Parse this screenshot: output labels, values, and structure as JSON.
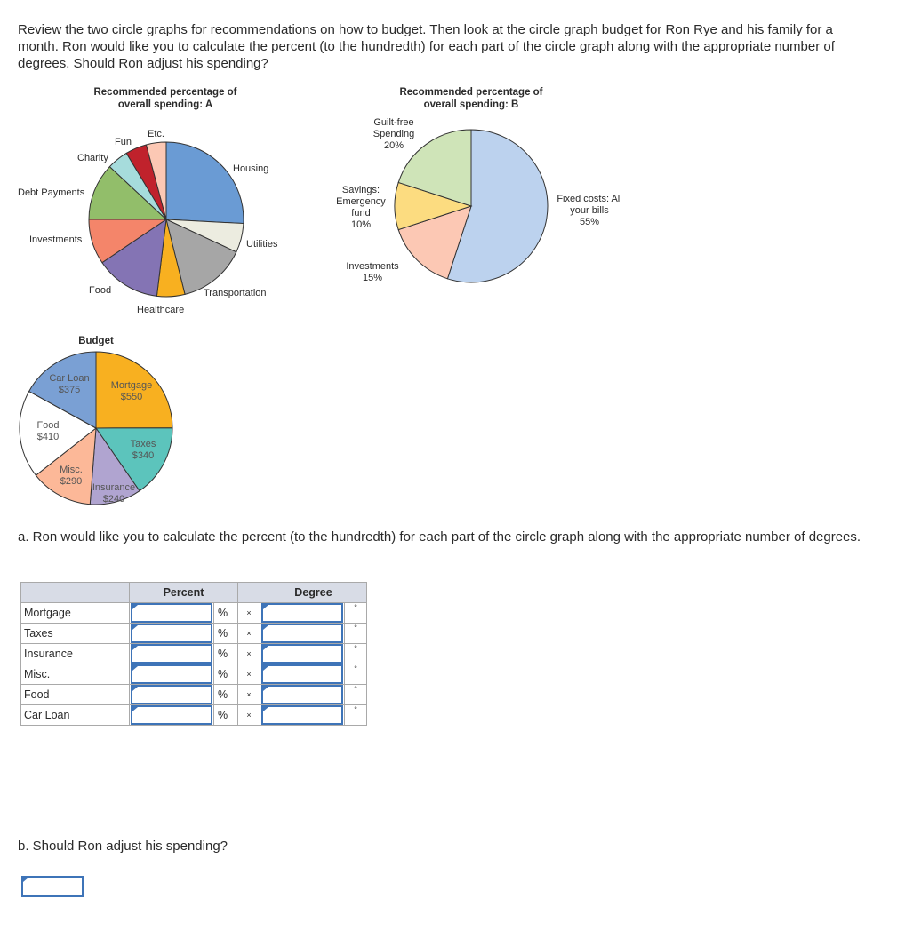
{
  "intro": "Review the two circle graphs for recommendations on how to budget. Then look at the circle graph budget for Ron Rye and his family for a month. Ron would like you to calculate the percent (to the hundredth) for each part of the circle graph along with the appropriate number of degrees. Should Ron adjust his spending?",
  "chart_data": [
    {
      "type": "pie",
      "title": "Recommended percentage of overall spending: A",
      "title_l1": "Recommended percentage of",
      "title_l2": "overall spending: A",
      "slices": [
        {
          "label": "Housing",
          "color": "#6a9bd4",
          "approx_deg": 93
        },
        {
          "label": "Utilities",
          "color": "#ecece0",
          "approx_deg": 22
        },
        {
          "label": "Transportation",
          "color": "#a6a6a6",
          "approx_deg": 51
        },
        {
          "label": "Healthcare",
          "color": "#f8b020",
          "approx_deg": 21
        },
        {
          "label": "Food",
          "color": "#8474b4",
          "approx_deg": 49
        },
        {
          "label": "Investments",
          "color": "#f4856a",
          "approx_deg": 34
        },
        {
          "label": "Debt Payments",
          "color": "#92be6a",
          "approx_deg": 43
        },
        {
          "label": "Charity",
          "color": "#a6dcdc",
          "approx_deg": 16
        },
        {
          "label": "Fun",
          "color": "#c0222c",
          "approx_deg": 16
        },
        {
          "label": "Etc.",
          "color": "#fcc8b4",
          "approx_deg": 15
        }
      ]
    },
    {
      "type": "pie",
      "title": "Recommended percentage of overall spending: B",
      "title_l1": "Recommended percentage of",
      "title_l2": "overall spending: B",
      "slices": [
        {
          "label": "Fixed costs: All your bills",
          "l1": "Fixed costs: All",
          "l2": "your bills",
          "pct_label": "55%",
          "value": 55,
          "color": "#bcd2ee"
        },
        {
          "label": "Investments",
          "l1": "Investments",
          "pct_label": "15%",
          "value": 15,
          "color": "#fcc8b4"
        },
        {
          "label": "Savings: Emergency fund",
          "l1": "Savings:",
          "l2": "Emergency",
          "l3": "fund",
          "pct_label": "10%",
          "value": 10,
          "color": "#fcdc80"
        },
        {
          "label": "Guilt-free Spending",
          "l1": "Guilt-free",
          "l2": "Spending",
          "pct_label": "20%",
          "value": 20,
          "color": "#cfe4b8"
        }
      ]
    },
    {
      "type": "pie",
      "title": "Budget",
      "slices": [
        {
          "label": "Mortgage",
          "amount": "$550",
          "value": 550,
          "color": "#f8b020"
        },
        {
          "label": "Taxes",
          "amount": "$340",
          "value": 340,
          "color": "#5cc4bc"
        },
        {
          "label": "Insurance",
          "amount": "$240",
          "value": 240,
          "color": "#b0a4d0"
        },
        {
          "label": "Misc.",
          "amount": "$290",
          "value": 290,
          "color": "#fcb898"
        },
        {
          "label": "Food",
          "amount": "$410",
          "value": 410,
          "color": "#ffffff"
        },
        {
          "label": "Car Loan",
          "amount": "$375",
          "value": 375,
          "color": "#7aa0d4"
        }
      ]
    }
  ],
  "question_a": "a. Ron would like you to calculate the percent (to the hundredth) for each part of the circle graph along with the appropriate number of degrees.",
  "table": {
    "h_percent": "Percent",
    "h_degree": "Degree",
    "pct_sym": "%",
    "x_sym": "×",
    "deg_sym": "°",
    "rows": [
      "Mortgage",
      "Taxes",
      "Insurance",
      "Misc.",
      "Food",
      "Car Loan"
    ]
  },
  "question_b": "b. Should Ron adjust his spending?"
}
